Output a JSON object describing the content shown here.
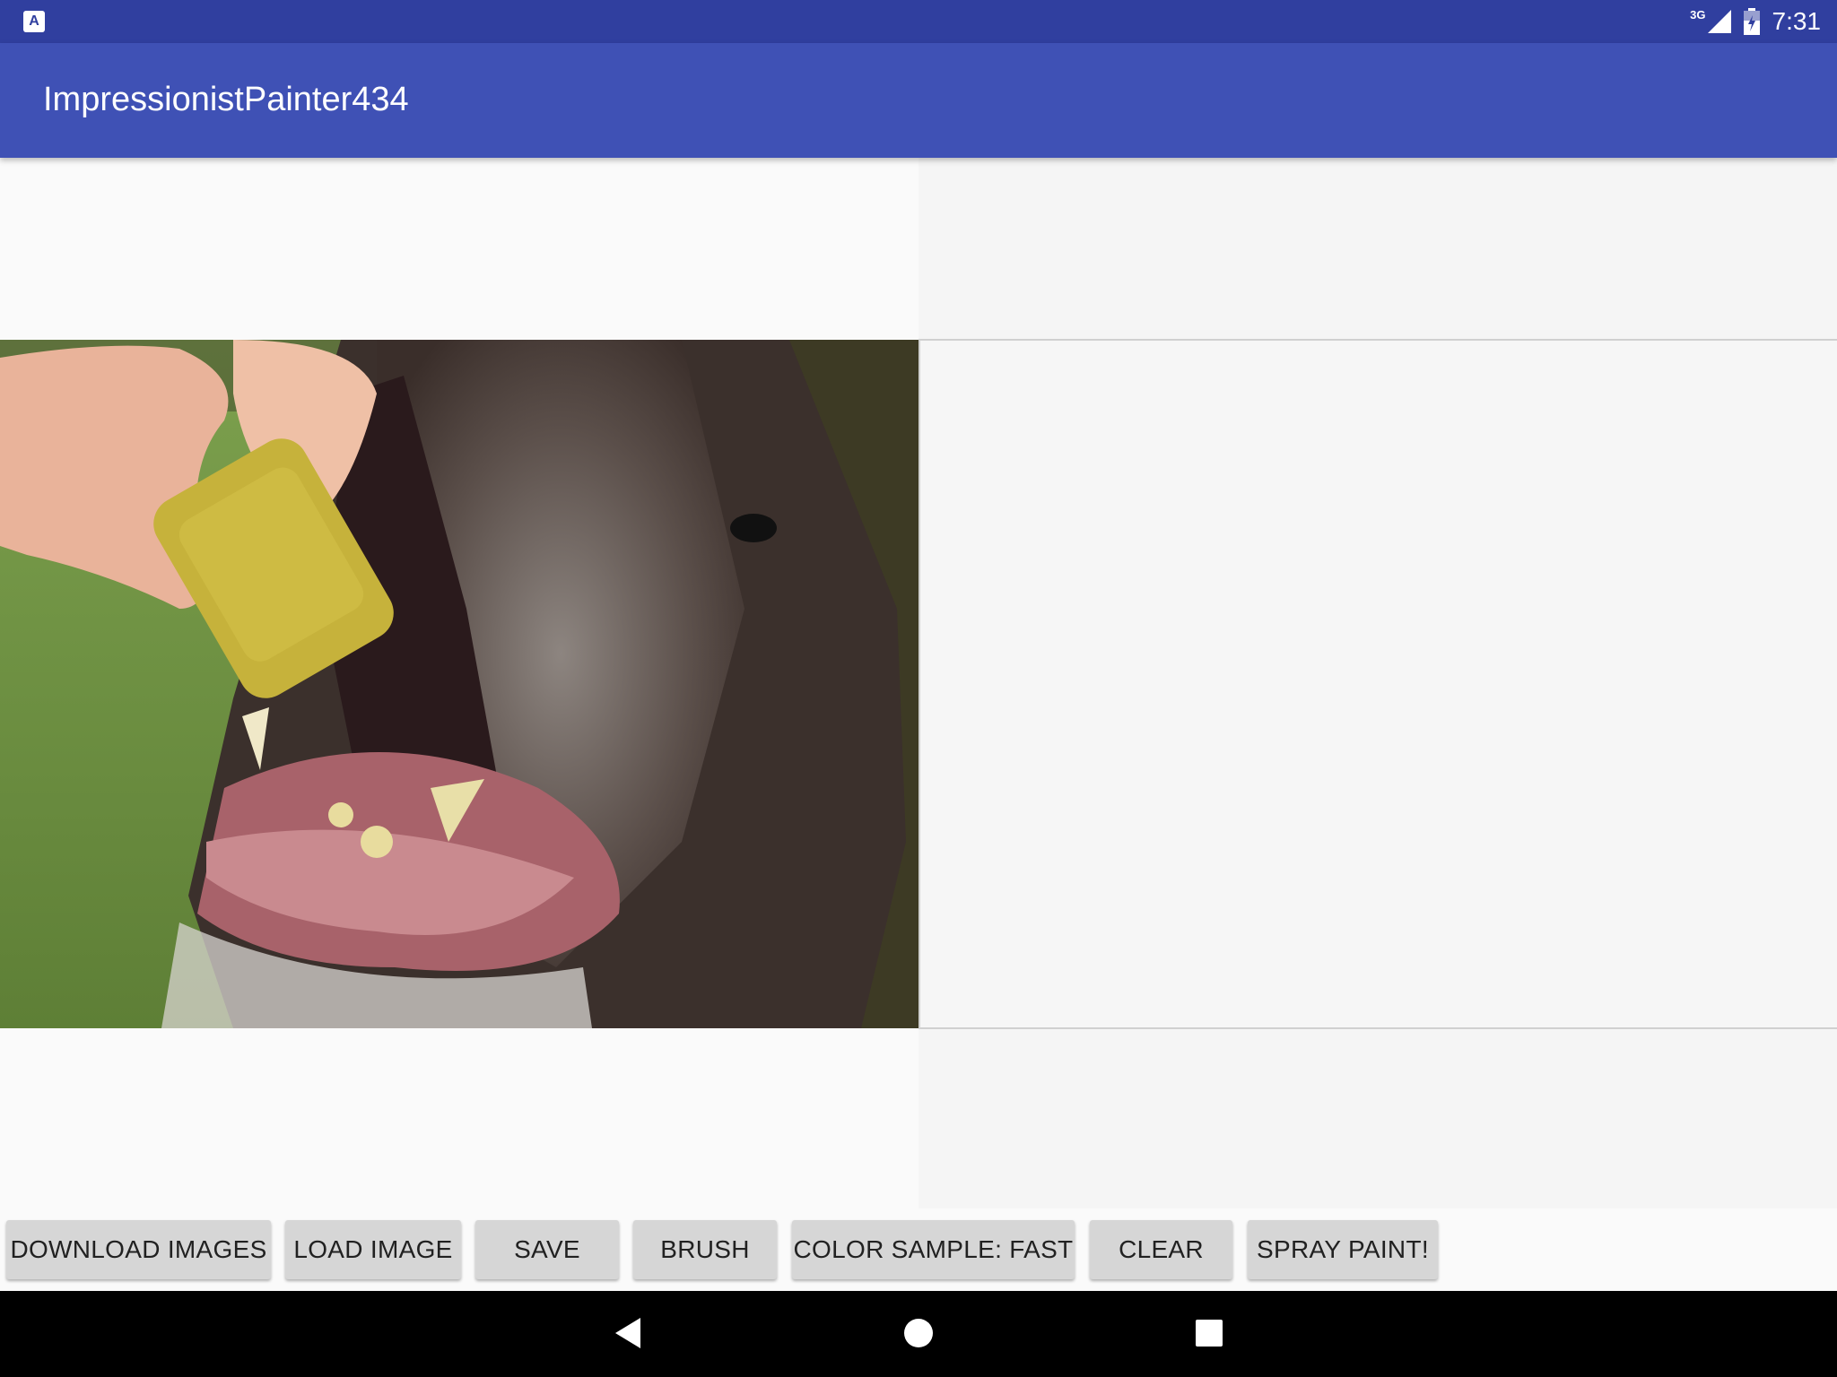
{
  "status_bar": {
    "app_icon_letter": "A",
    "network_type": "3G",
    "time": "7:31"
  },
  "app_bar": {
    "title": "ImpressionistPainter434"
  },
  "source_image": {
    "description_icon": "photo-of-dog-eating-biscuit"
  },
  "toolbar": {
    "buttons": [
      "DOWNLOAD IMAGES",
      "LOAD IMAGE",
      "SAVE",
      "BRUSH",
      "COLOR SAMPLE: FAST",
      "CLEAR",
      "SPRAY PAINT!"
    ]
  },
  "nav_bar": {
    "icons": [
      "back-icon",
      "home-icon",
      "recents-icon"
    ]
  },
  "colors": {
    "status_bar": "#303f9f",
    "app_bar": "#3f51b5",
    "button": "#d6d6d6"
  }
}
